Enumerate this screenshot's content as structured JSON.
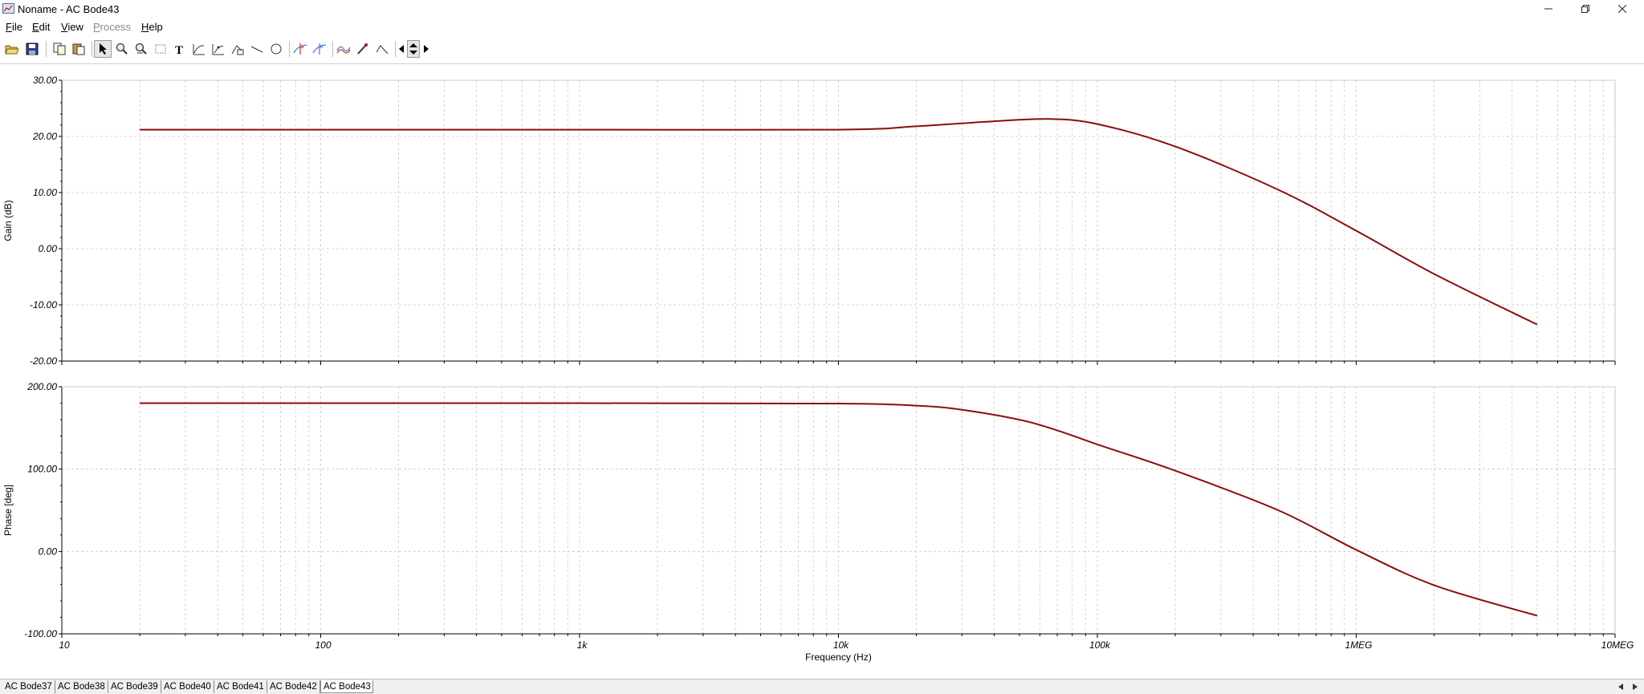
{
  "window": {
    "title": "Noname - AC Bode43"
  },
  "menu": [
    {
      "key": "file",
      "label": "File",
      "mnemonic": "F",
      "rest": "ile",
      "disabled": false
    },
    {
      "key": "edit",
      "label": "Edit",
      "mnemonic": "E",
      "rest": "dit",
      "disabled": false
    },
    {
      "key": "view",
      "label": "View",
      "mnemonic": "V",
      "rest": "iew",
      "disabled": false
    },
    {
      "key": "process",
      "label": "Process",
      "mnemonic": "P",
      "rest": "rocess",
      "disabled": true
    },
    {
      "key": "help",
      "label": "Help",
      "mnemonic": "H",
      "rest": "elp",
      "disabled": false
    }
  ],
  "toolbar": {
    "icons": [
      "open-icon",
      "save-icon",
      "copy-icon",
      "paste-icon",
      "pointer-icon",
      "zoom-in-icon",
      "zoom-out-icon",
      "select-region-icon",
      "text-icon",
      "curve-icon",
      "curve-tool-icon",
      "axis-icon",
      "line-icon",
      "ellipse-icon",
      "cursor-a-icon",
      "cursor-b-icon",
      "waveform-icon",
      "marker-icon",
      "step-icon",
      "arrow-left-icon",
      "arrow-updown-icon",
      "arrow-right-icon"
    ]
  },
  "tabs": [
    "AC Bode37",
    "AC Bode38",
    "AC Bode39",
    "AC Bode40",
    "AC Bode41",
    "AC Bode42",
    "AC Bode43"
  ],
  "active_tab": "AC Bode43",
  "colors": {
    "trace": "#8b0d0d",
    "grid": "#c8c8c8"
  },
  "chart_data": [
    {
      "type": "line",
      "ylabel": "Gain (dB)",
      "xscale": "log",
      "xlim": [
        10,
        10000000
      ],
      "ylim": [
        -20,
        30
      ],
      "yticks": [
        30,
        20,
        10,
        0,
        -10,
        -20
      ],
      "ytick_labels": [
        "30.00",
        "20.00",
        "10.00",
        "0.00",
        "-10.00",
        "-20.00"
      ],
      "grid": true,
      "series": [
        {
          "x": [
            20,
            100,
            1000,
            10000,
            20000,
            40000,
            65000,
            100000,
            200000,
            500000,
            1000000,
            2000000,
            5000000
          ],
          "y": [
            21.2,
            21.2,
            21.2,
            21.2,
            21.8,
            22.7,
            23.1,
            22.2,
            18.2,
            10.5,
            3.2,
            -4.5,
            -13.5
          ]
        }
      ]
    },
    {
      "type": "line",
      "ylabel": "Phase [deg]",
      "xlabel": "Frequency (Hz)",
      "xscale": "log",
      "xlim": [
        10,
        10000000
      ],
      "ylim": [
        -100,
        200
      ],
      "yticks": [
        200,
        100,
        0,
        -100
      ],
      "ytick_labels": [
        "200.00",
        "100.00",
        "0.00",
        "-100.00"
      ],
      "xticks": [
        10,
        100,
        1000,
        10000,
        100000,
        1000000,
        10000000
      ],
      "xtick_labels": [
        "10",
        "100",
        "1k",
        "10k",
        "100k",
        "1MEG",
        "10MEG"
      ],
      "grid": true,
      "series": [
        {
          "x": [
            20,
            1000,
            10000,
            20000,
            30000,
            50000,
            70000,
            100000,
            200000,
            500000,
            1000000,
            2000000,
            5000000
          ],
          "y": [
            180,
            180,
            179.5,
            177,
            172,
            160,
            147,
            130,
            98,
            50,
            2,
            -41,
            -78
          ]
        }
      ]
    }
  ]
}
